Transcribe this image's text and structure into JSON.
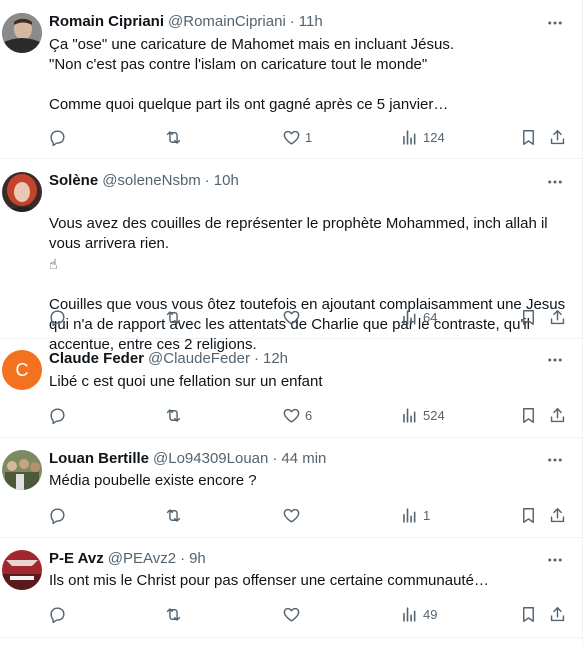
{
  "tweets": [
    {
      "name": "Romain Cipriani",
      "handle": "@RomainCipriani",
      "time": "11h",
      "text": "Ça \"ose\" une caricature de Mahomet mais en incluant Jésus.\n\"Non c'est pas contre l'islam on caricature tout le monde\"\n\nComme quoi quelque part ils ont gagné après ce 5 janvier…",
      "likes": "1",
      "views": "124",
      "avatar_color": "#6b6b6b"
    },
    {
      "name": "Solène",
      "handle": "@soleneNsbm",
      "time": "10h",
      "text_line1": "Vous avez des couilles de représenter le prophète Mohammed, inch allah il vous arrivera rien.",
      "emoji": "☝",
      "text_line2": "Couilles que vous vous ôtez toutefois en ajoutant complaisamment une Jesus qui n'a de rapport avec les attentats de Charlie que par le contraste, qu'il accentue, entre ces 2 religions.",
      "likes": "",
      "views": "64",
      "avatar_color": "#b3402a"
    },
    {
      "name": "Claude Feder",
      "handle": "@ClaudeFeder",
      "time": "12h",
      "text": "Libé c est quoi une fellation sur un enfant",
      "likes": "6",
      "views": "524",
      "avatar_letter": "C",
      "avatar_color": "#f4711f"
    },
    {
      "name": "Louan Bertille",
      "handle": "@Lo94309Louan",
      "time": "44 min",
      "text": "Média poubelle existe encore ?",
      "likes": "",
      "views": "1",
      "avatar_color": "#5f6e48"
    },
    {
      "name": "P-E Avz",
      "handle": "@PEAvz2",
      "time": "9h",
      "text": "Ils ont mis le Christ pour pas offenser une certaine communauté…",
      "likes": "",
      "views": "49",
      "avatar_color": "#a1262d"
    }
  ],
  "colors": {
    "text": "#0f1419",
    "secondary": "#536471",
    "border": "#eff3f4"
  }
}
